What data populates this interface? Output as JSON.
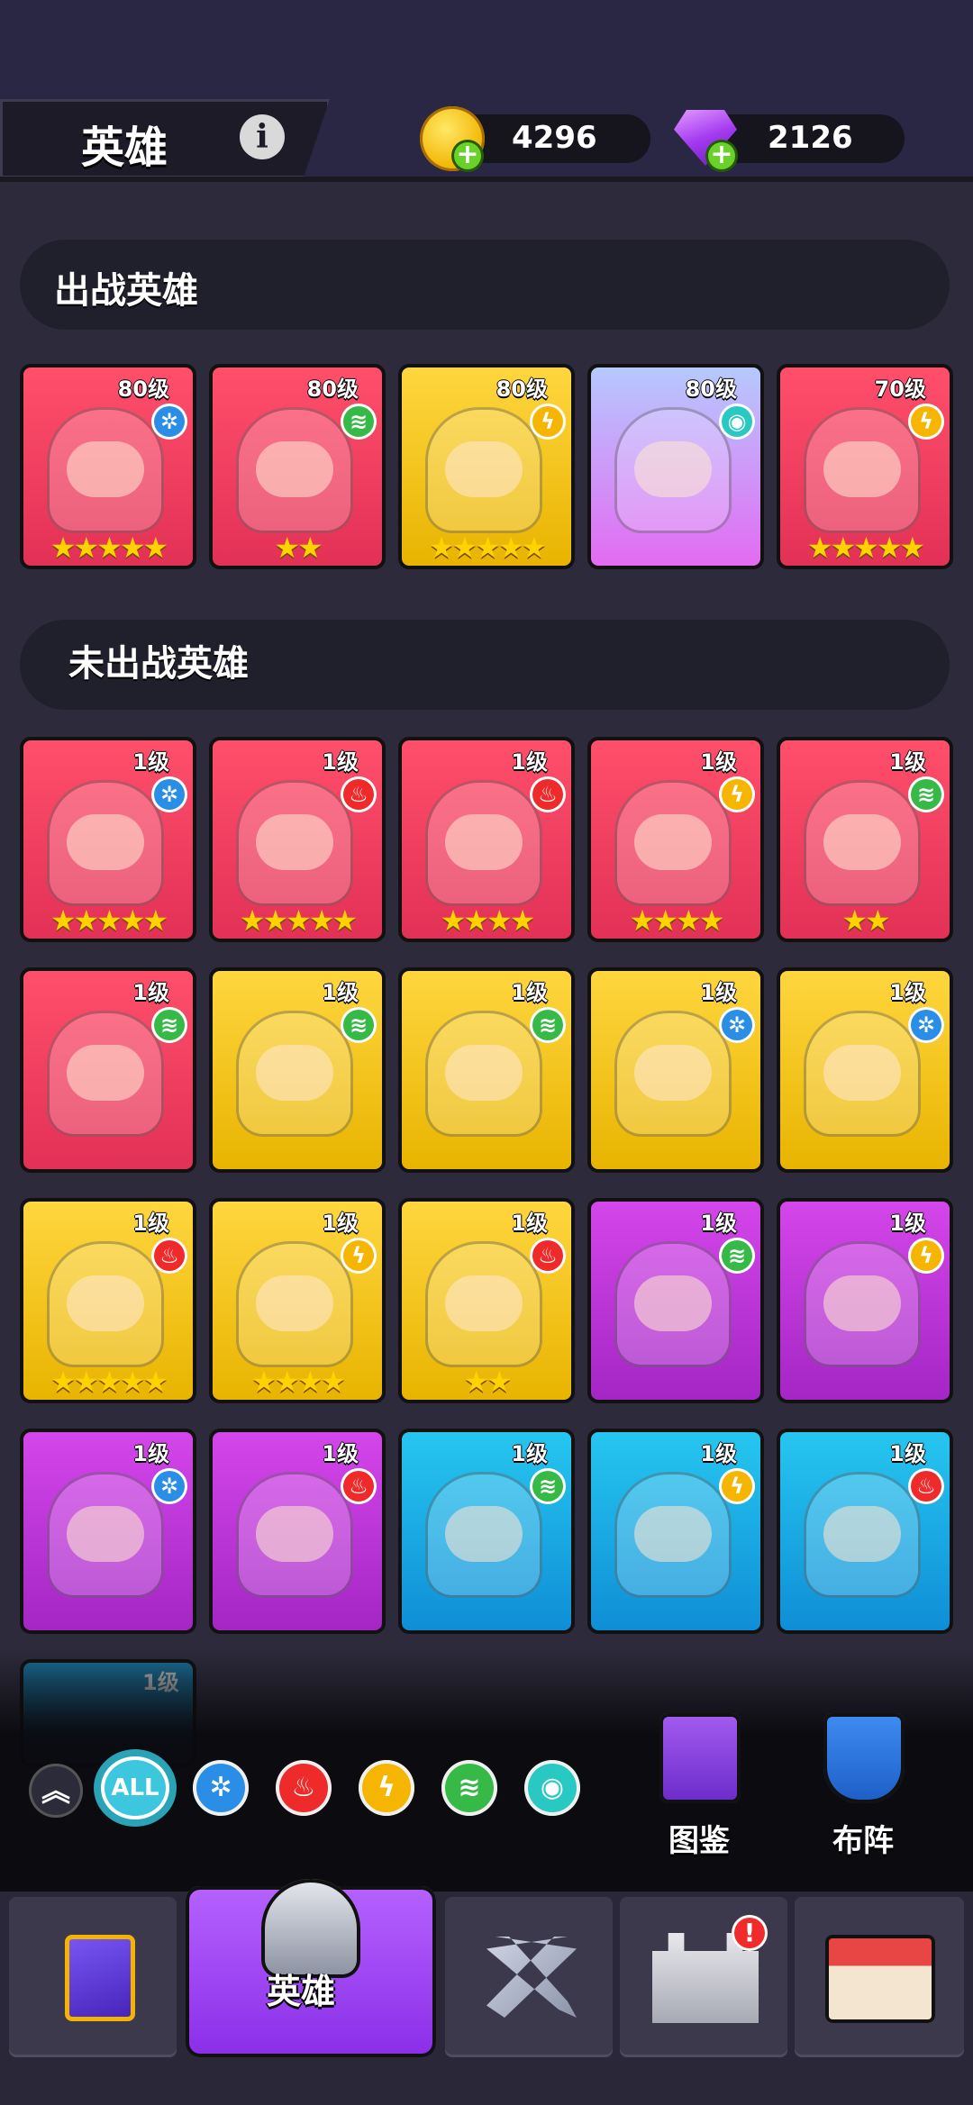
{
  "header": {
    "title": "英雄",
    "info_icon": "info-icon",
    "coins": "4296",
    "gems": "2126",
    "coin_icon": "gold-coin-icon",
    "gem_icon": "purple-gem-icon"
  },
  "deployed_section": {
    "title": "出战英雄",
    "heroes": [
      {
        "level": "80级",
        "element": "ice",
        "stars": "★★★★★",
        "bg": "red"
      },
      {
        "level": "80级",
        "element": "wind",
        "stars": "★★",
        "bg": "red"
      },
      {
        "level": "80级",
        "element": "lightning",
        "stars": "★★★★★",
        "bg": "yellow"
      },
      {
        "level": "80级",
        "element": "eye",
        "stars": "",
        "bg": "pink"
      },
      {
        "level": "70级",
        "element": "lightning",
        "stars": "★★★★★",
        "bg": "red"
      }
    ]
  },
  "undeployed_section": {
    "title": "未出战英雄",
    "heroes": [
      {
        "level": "1级",
        "element": "ice",
        "stars": "★★★★★",
        "bg": "red"
      },
      {
        "level": "1级",
        "element": "fire",
        "stars": "★★★★★",
        "bg": "red"
      },
      {
        "level": "1级",
        "element": "fire",
        "stars": "★★★★",
        "bg": "red"
      },
      {
        "level": "1级",
        "element": "lightning",
        "stars": "★★★★",
        "bg": "red"
      },
      {
        "level": "1级",
        "element": "wind",
        "stars": "★★",
        "bg": "red"
      },
      {
        "level": "1级",
        "element": "wind",
        "stars": "",
        "bg": "red"
      },
      {
        "level": "1级",
        "element": "wind",
        "stars": "",
        "bg": "yellow"
      },
      {
        "level": "1级",
        "element": "wind",
        "stars": "",
        "bg": "yellow"
      },
      {
        "level": "1级",
        "element": "ice",
        "stars": "",
        "bg": "yellow"
      },
      {
        "level": "1级",
        "element": "ice",
        "stars": "",
        "bg": "yellow"
      },
      {
        "level": "1级",
        "element": "fire",
        "stars": "★★★★★",
        "bg": "yellow"
      },
      {
        "level": "1级",
        "element": "lightning",
        "stars": "★★★★",
        "bg": "yellow"
      },
      {
        "level": "1级",
        "element": "fire",
        "stars": "★★",
        "bg": "yellow"
      },
      {
        "level": "1级",
        "element": "wind",
        "stars": "",
        "bg": "purple"
      },
      {
        "level": "1级",
        "element": "lightning",
        "stars": "",
        "bg": "purple"
      },
      {
        "level": "1级",
        "element": "ice",
        "stars": "",
        "bg": "purple"
      },
      {
        "level": "1级",
        "element": "fire",
        "stars": "",
        "bg": "purple"
      },
      {
        "level": "1级",
        "element": "wind",
        "stars": "",
        "bg": "blue"
      },
      {
        "level": "1级",
        "element": "lightning",
        "stars": "",
        "bg": "blue"
      },
      {
        "level": "1级",
        "element": "fire",
        "stars": "",
        "bg": "blue"
      }
    ],
    "partial_level": "1级"
  },
  "filters": {
    "collapse_icon": "double-chevron-up-icon",
    "all_label": "ALL",
    "items": [
      "ice",
      "fire",
      "lightning",
      "wind",
      "eye"
    ]
  },
  "actions": {
    "codex_label": "图鉴",
    "formation_label": "布阵"
  },
  "nav": {
    "active_label": "英雄",
    "badge": "!"
  }
}
